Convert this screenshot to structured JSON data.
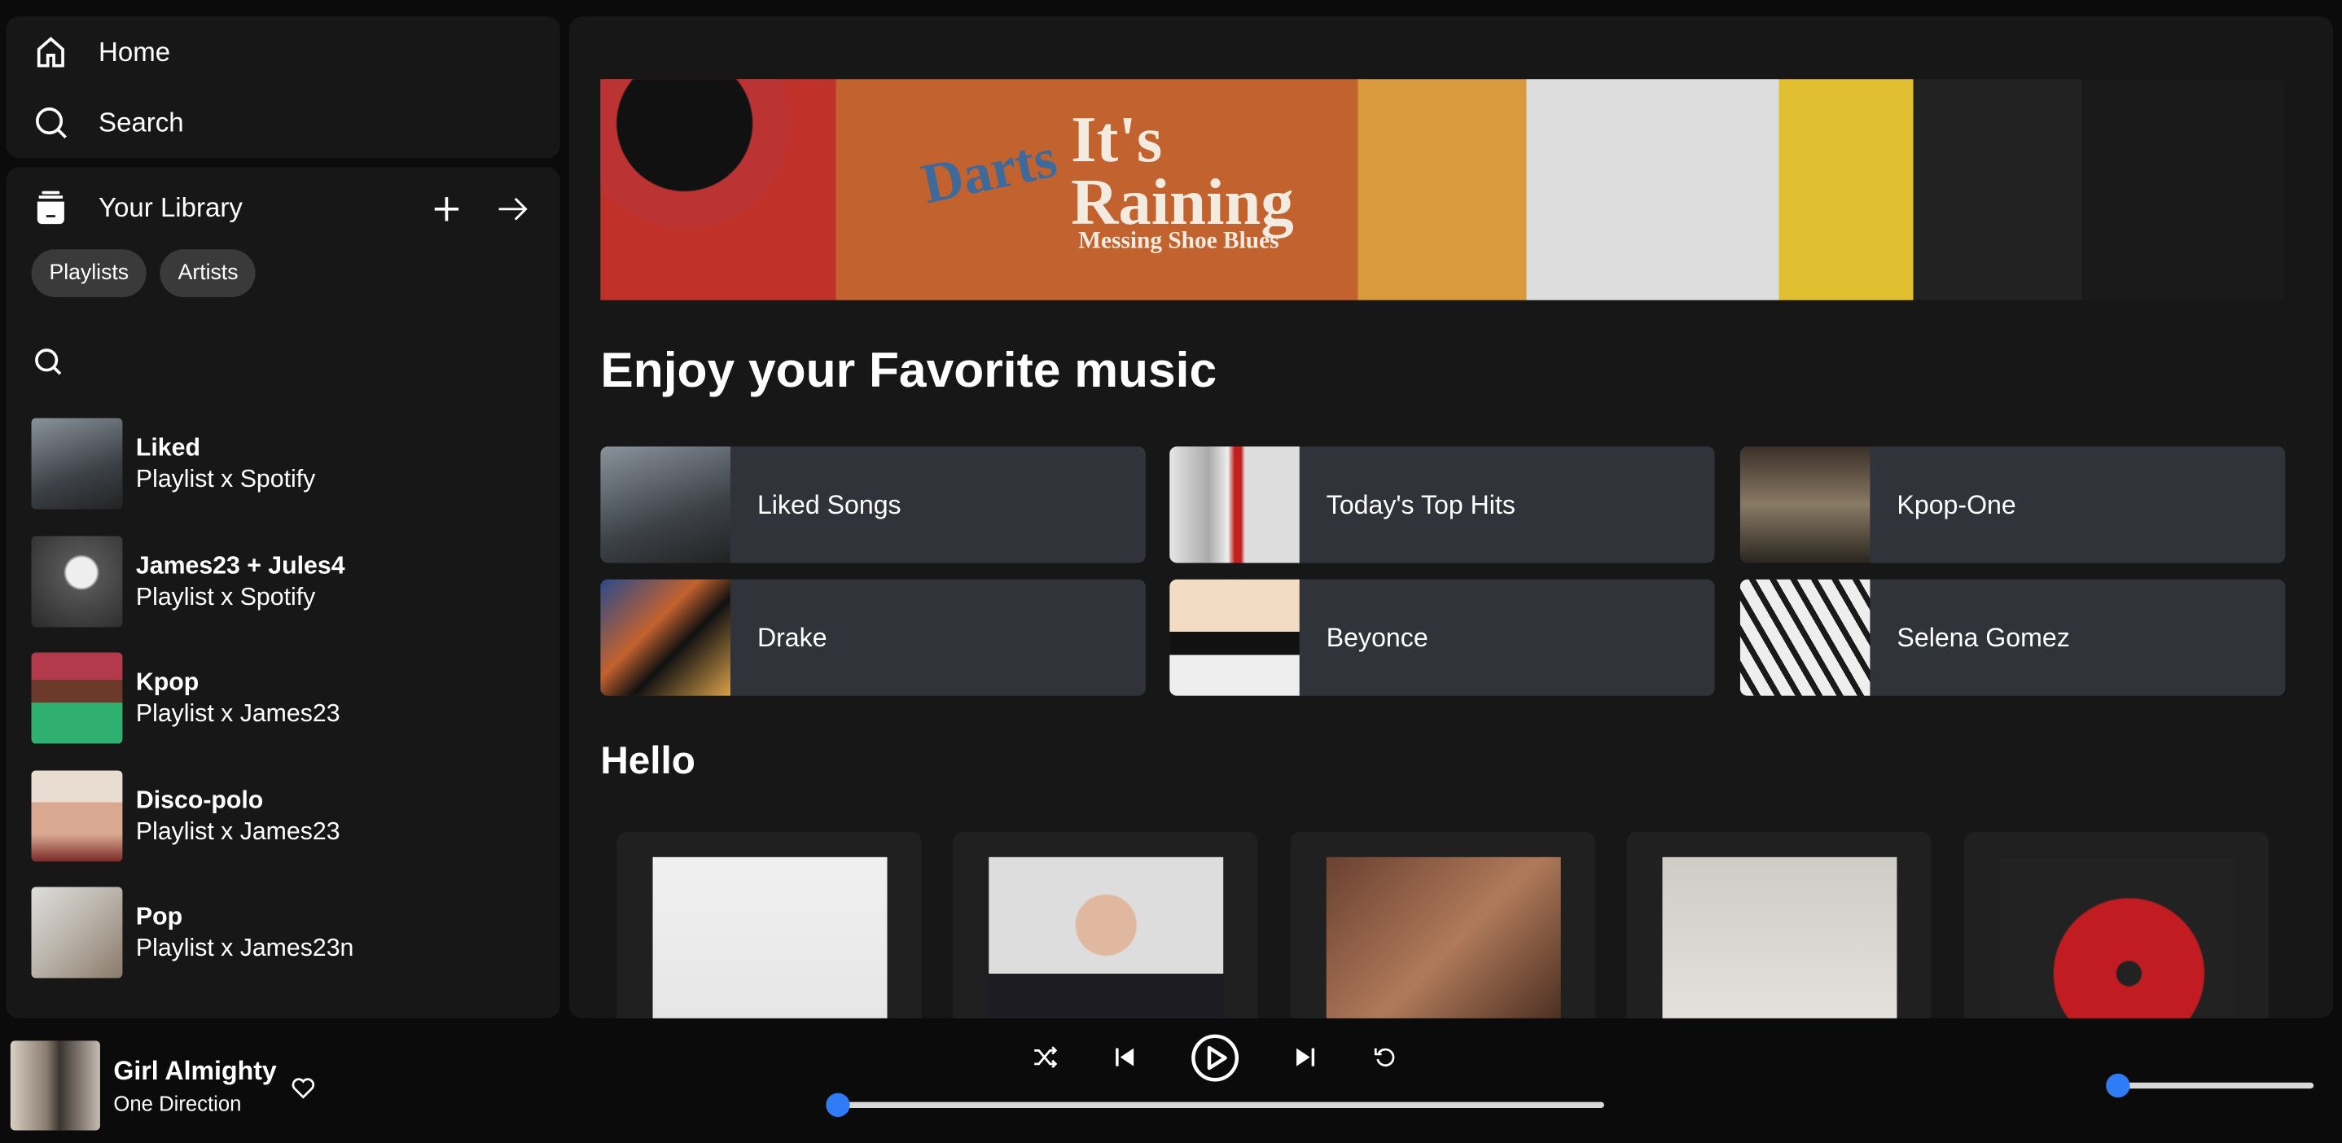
{
  "nav": {
    "home": "Home",
    "search": "Search"
  },
  "library": {
    "title": "Your Library",
    "filters": [
      "Playlists",
      "Artists"
    ],
    "items": [
      {
        "title": "Liked",
        "subtitle": "Playlist x Spotify"
      },
      {
        "title": "James23 + Jules4",
        "subtitle": "Playlist x Spotify"
      },
      {
        "title": "Kpop",
        "subtitle": "Playlist x James23"
      },
      {
        "title": "Disco-polo",
        "subtitle": "Playlist x James23"
      },
      {
        "title": "Pop",
        "subtitle": "Playlist x James23n"
      }
    ]
  },
  "main": {
    "banner_text": [
      "Darts",
      "It's Raining",
      "Messing Shoe Blues"
    ],
    "heading": "Enjoy your Favorite music",
    "quick": [
      "Liked Songs",
      "Today's Top Hits",
      "Kpop-One",
      "Drake",
      "Beyonce",
      "Selena Gomez"
    ],
    "section": "Hello"
  },
  "player": {
    "title": "Girl Almighty",
    "artist": "One Direction",
    "progress_percent": 0,
    "volume_percent": 0,
    "accent": "#2f7cf6"
  }
}
